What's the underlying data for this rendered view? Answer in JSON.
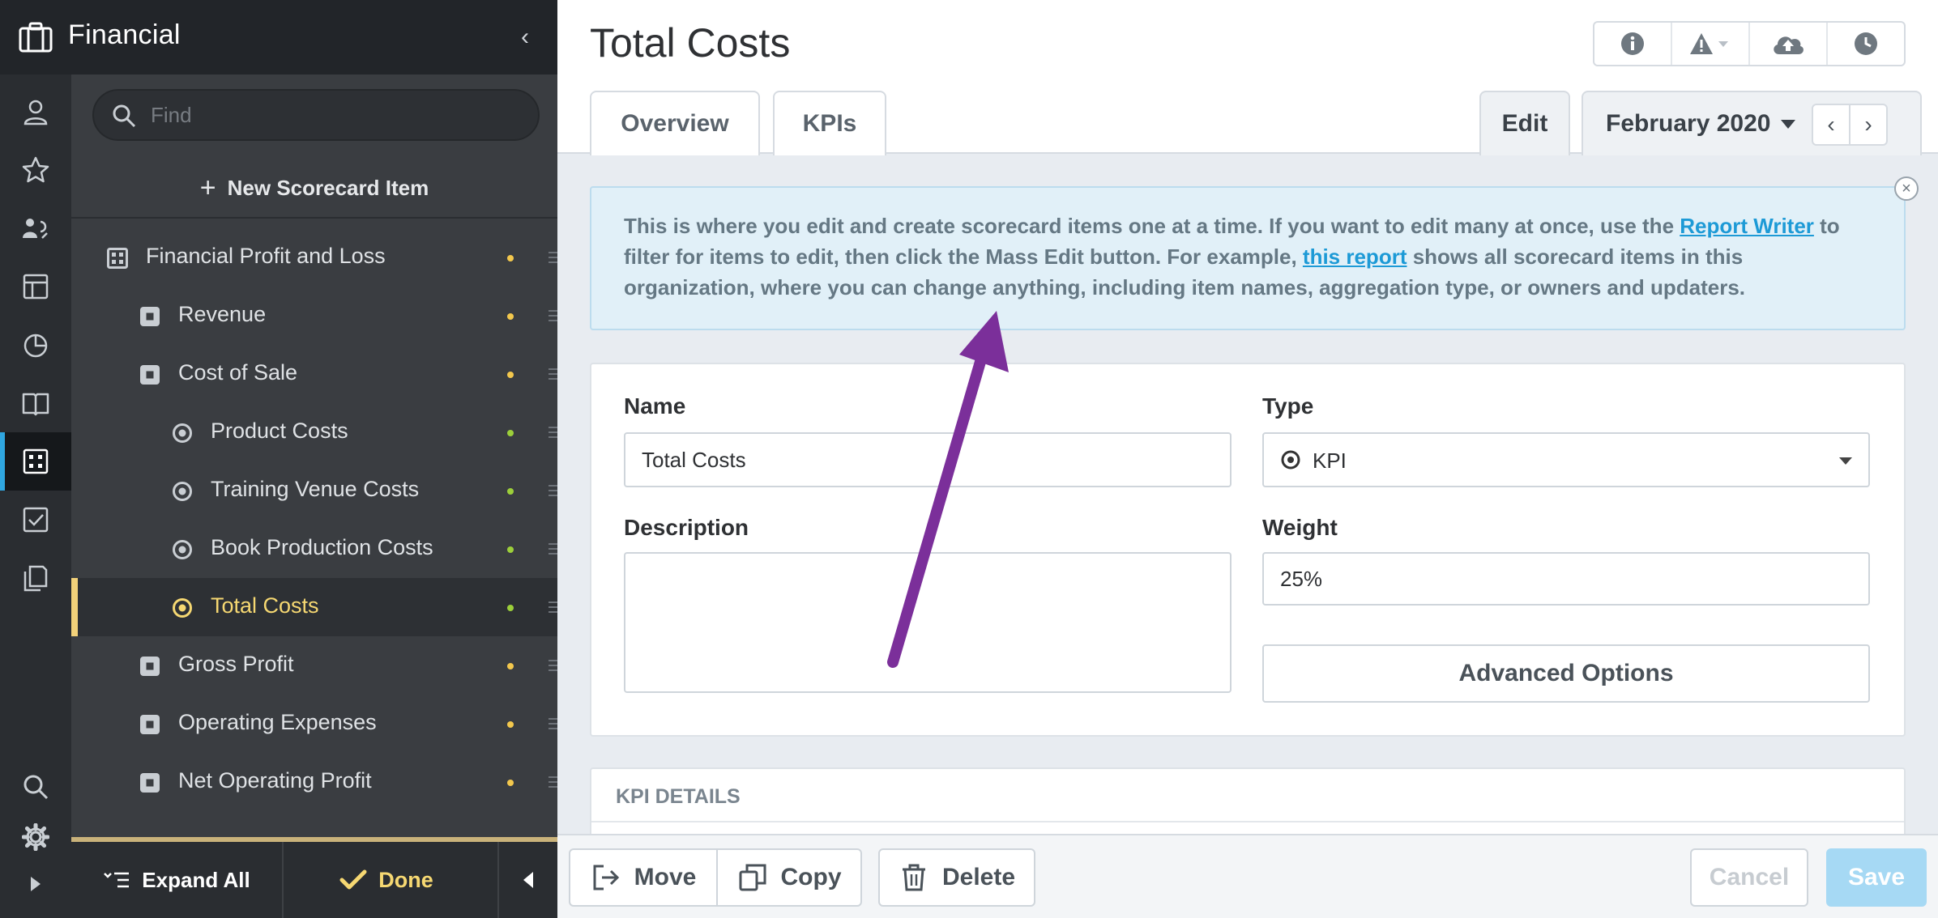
{
  "app": {
    "title": "Financial",
    "collapse_glyph": "‹"
  },
  "rail": {
    "icons": [
      "user-icon",
      "star-icon",
      "people-icon",
      "dashboard-icon",
      "pie-chart-icon",
      "book-icon",
      "scorecard-icon",
      "checkbox-icon",
      "documents-icon"
    ],
    "active": "scorecard-icon",
    "footer_icons": [
      "search-icon",
      "gear-icon",
      "expand-rail-icon"
    ]
  },
  "sidebar": {
    "find_placeholder": "Find",
    "new_item_plus": "+",
    "new_item_label": "New Scorecard Item",
    "items": [
      {
        "label": "Financial Profit and Loss",
        "type": "scorecard",
        "status": "#f3c84d"
      },
      {
        "label": "Revenue",
        "type": "objective",
        "status": "#f3c84d"
      },
      {
        "label": "Cost of Sale",
        "type": "objective",
        "status": "#f3c84d"
      },
      {
        "label": "Product Costs",
        "type": "kpi",
        "status": "#9ccf3a"
      },
      {
        "label": "Training Venue Costs",
        "type": "kpi",
        "status": "#9ccf3a"
      },
      {
        "label": "Book Production Costs",
        "type": "kpi",
        "status": "#9ccf3a"
      },
      {
        "label": "Total Costs",
        "type": "kpi",
        "status": "#9ccf3a",
        "selected": true
      },
      {
        "label": "Gross Profit",
        "type": "objective",
        "status": "#f3c84d"
      },
      {
        "label": "Operating Expenses",
        "type": "objective",
        "status": "#f3c84d"
      },
      {
        "label": "Net Operating Profit",
        "type": "objective",
        "status": "#f3c84d"
      }
    ],
    "footer": {
      "expand_all": "Expand All",
      "done": "Done",
      "back_glyph": "◀"
    }
  },
  "header": {
    "title": "Total Costs",
    "tools": [
      "info-icon",
      "alert-icon",
      "cloud-upload-icon",
      "history-icon"
    ],
    "tabs": [
      "Overview",
      "KPIs"
    ],
    "edit_tab": "Edit",
    "period": "February 2020",
    "prev_glyph": "‹",
    "next_glyph": "›"
  },
  "info_banner": {
    "text_1": "This is where you edit and create scorecard items one at a time. If you want to edit many at once, use the ",
    "link_1": "Report Writer",
    "text_2": " to filter for items to edit, then click the Mass Edit button. For example, ",
    "link_2": "this report",
    "text_3": " shows all scorecard items in this organization, where you can change anything, including item names, aggregation type, or owners and updaters.",
    "close_glyph": "×"
  },
  "form": {
    "name_label": "Name",
    "name_value": "Total Costs",
    "type_label": "Type",
    "type_value": "KPI",
    "description_label": "Description",
    "description_value": "",
    "weight_label": "Weight",
    "weight_value": "25%",
    "advanced_label": "Advanced Options"
  },
  "kpi_details": {
    "title": "KPI DETAILS"
  },
  "actions": {
    "move": "Move",
    "copy": "Copy",
    "delete": "Delete",
    "cancel": "Cancel",
    "save": "Save"
  },
  "colors": {
    "accent": "#2fa6e0",
    "selected": "#f6d872",
    "annotation_arrow": "#7b2f9a"
  }
}
